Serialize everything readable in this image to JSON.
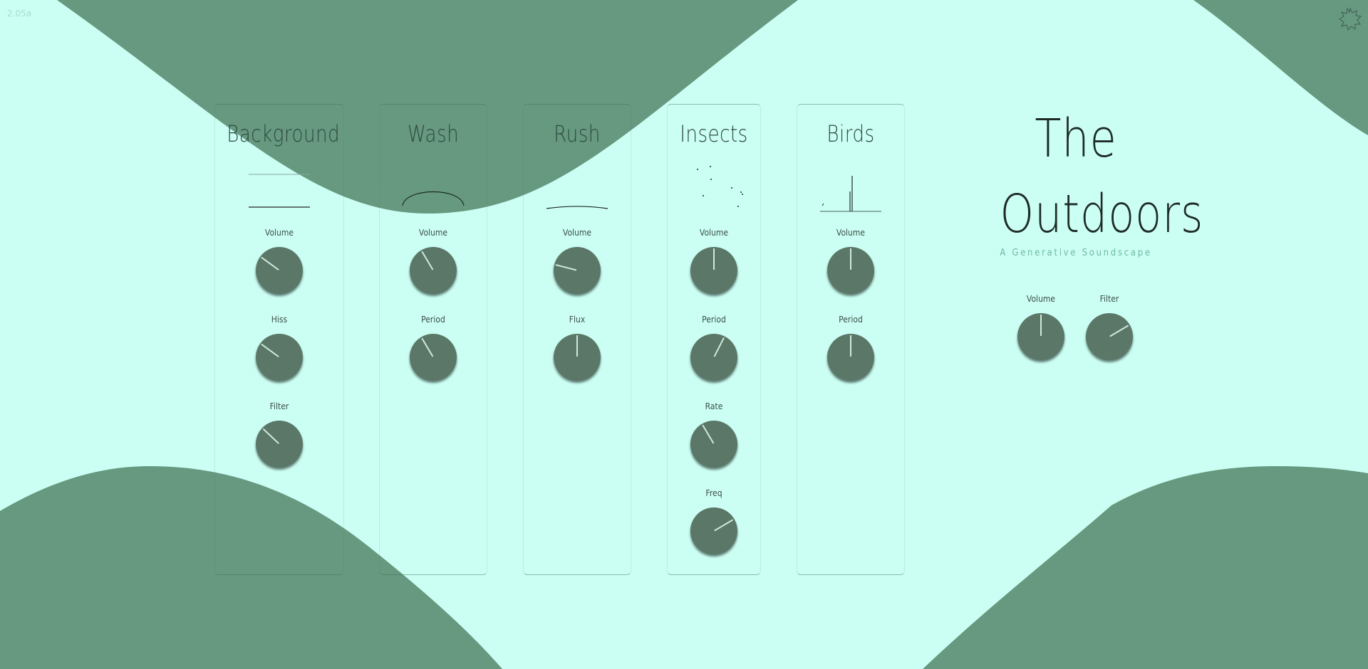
{
  "app": {
    "version": "2.05a",
    "title_line1": "The",
    "title_line2": "Outdoors",
    "subtitle": "A Generative Soundscape"
  },
  "colors": {
    "background": "#ccfff3",
    "hills": "#66997f",
    "knob": "#5a7768",
    "indicator": "#cfe9df"
  },
  "icons": {
    "settings": "gear-icon"
  },
  "master": {
    "knobs": [
      {
        "label": "Volume",
        "value": 0.5
      },
      {
        "label": "Filter",
        "value": 0.83
      }
    ]
  },
  "panels": [
    {
      "title": "Background",
      "viz": "flat-lines",
      "knobs": [
        {
          "label": "Volume",
          "value": 0.2
        },
        {
          "label": "Hiss",
          "value": 0.2
        },
        {
          "label": "Filter",
          "value": 0.24
        }
      ]
    },
    {
      "title": "Wash",
      "viz": "arc",
      "knobs": [
        {
          "label": "Volume",
          "value": 0.33
        },
        {
          "label": "Period",
          "value": 0.33
        }
      ]
    },
    {
      "title": "Rush",
      "viz": "wave",
      "knobs": [
        {
          "label": "Volume",
          "value": 0.08
        },
        {
          "label": "Flux",
          "value": 0.5
        }
      ]
    },
    {
      "title": "Insects",
      "viz": "dots",
      "knobs": [
        {
          "label": "Volume",
          "value": 0.5
        },
        {
          "label": "Period",
          "value": 0.65
        },
        {
          "label": "Rate",
          "value": 0.33
        },
        {
          "label": "Freq",
          "value": 0.83
        }
      ]
    },
    {
      "title": "Birds",
      "viz": "spikes",
      "knobs": [
        {
          "label": "Volume",
          "value": 0.5
        },
        {
          "label": "Period",
          "value": 0.5
        }
      ]
    }
  ]
}
